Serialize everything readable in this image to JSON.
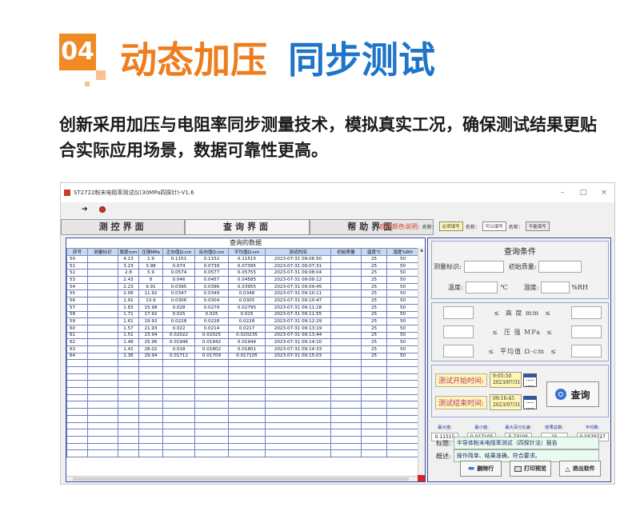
{
  "hero": {
    "badge": "04",
    "title_part1": "动态加压",
    "title_part2": "同步测试",
    "intro": "创新采用加压与电阻率同步测量技术，模拟真实工况，确保测试结果更贴合实际应用场景，数据可靠性更高。"
  },
  "window": {
    "title": "ST2722粉末电阻率测试仪(30MPa四探针)-V1.6",
    "controls": [
      "–",
      "□",
      "×"
    ]
  },
  "tabs": [
    {
      "label": "测控界面"
    },
    {
      "label": "查询界面"
    },
    {
      "label": "帮助界面"
    }
  ],
  "legend": {
    "title": "底纹颜色说明:",
    "items": [
      {
        "name": "名称：",
        "swatch": "必须填写",
        "style": "yellow"
      },
      {
        "name": "名称：",
        "swatch": "可以填写",
        "style": "white"
      },
      {
        "name": "名称：",
        "swatch": "不能填写",
        "style": "gray"
      }
    ]
  },
  "grid": {
    "title": "查询的数据",
    "columns": [
      "序号",
      "测量标识",
      "厚度mm",
      "压强MPa",
      "正向值Ω-cm",
      "反向值Ω-cm",
      "平均值Ω-cm",
      "测试时间",
      "初始质量",
      "温度℃",
      "湿度%RH"
    ],
    "rows": [
      [
        "50",
        "",
        "4.13",
        "1.9",
        "0.1151",
        "0.1152",
        "0.11515",
        "2023-07-31 09:06:50",
        "",
        "25",
        "50"
      ],
      [
        "51",
        "",
        "3.23",
        "3.98",
        "0.074",
        "0.0739",
        "0.07395",
        "2023-07-31 09:07:31",
        "",
        "25",
        "50"
      ],
      [
        "52",
        "",
        "2.8",
        "5.9",
        "0.0574",
        "0.0577",
        "0.05755",
        "2023-07-31 09:08:04",
        "",
        "25",
        "50"
      ],
      [
        "53",
        "",
        "2.43",
        "8",
        "0.046",
        "0.0457",
        "0.04585",
        "2023-07-31 09:09:12",
        "",
        "25",
        "50"
      ],
      [
        "54",
        "",
        "2.23",
        "9.91",
        "0.0395",
        "0.0396",
        "0.03955",
        "2023-07-31 09:09:45",
        "",
        "25",
        "50"
      ],
      [
        "55",
        "",
        "2.06",
        "11.92",
        "0.0347",
        "0.0349",
        "0.0348",
        "2023-07-31 09:10:11",
        "",
        "25",
        "50"
      ],
      [
        "56",
        "",
        "1.91",
        "13.9",
        "0.0306",
        "0.0304",
        "0.0305",
        "2023-07-31 09:10:47",
        "",
        "25",
        "50"
      ],
      [
        "57",
        "",
        "1.83",
        "15.98",
        "0.028",
        "0.0279",
        "0.02795",
        "2023-07-31 09:11:18",
        "",
        "25",
        "50"
      ],
      [
        "58",
        "",
        "1.71",
        "17.92",
        "0.025",
        "0.025",
        "0.025",
        "2023-07-31 09:11:55",
        "",
        "25",
        "50"
      ],
      [
        "59",
        "",
        "1.61",
        "19.92",
        "0.0228",
        "0.0228",
        "0.0228",
        "2023-07-31 09:12:29",
        "",
        "25",
        "50"
      ],
      [
        "60",
        "",
        "1.57",
        "21.93",
        "0.022",
        "0.0214",
        "0.0217",
        "2023-07-31 09:13:19",
        "",
        "25",
        "50"
      ],
      [
        "61",
        "",
        "1.51",
        "23.94",
        "0.02022",
        "0.02025",
        "0.020235",
        "2023-07-31 09:13:44",
        "",
        "25",
        "50"
      ],
      [
        "62",
        "",
        "1.48",
        "25.96",
        "0.01946",
        "0.01942",
        "0.01944",
        "2023-07-31 09:14:10",
        "",
        "25",
        "50"
      ],
      [
        "63",
        "",
        "1.41",
        "28.02",
        "0.018",
        "0.01802",
        "0.01801",
        "2023-07-31 09:14:33",
        "",
        "25",
        "50"
      ],
      [
        "64",
        "",
        "1.36",
        "29.94",
        "0.01712",
        "0.01709",
        "0.017105",
        "2023-07-31 09:15:03",
        "",
        "25",
        "50"
      ]
    ],
    "empty_rows": 14
  },
  "query": {
    "title": "查询条件",
    "measure_id_label": "测量标识:",
    "initial_mass_label": "初始质量:",
    "temp_label": "温度:",
    "temp_unit": "℃",
    "humidity_label": "湿度:",
    "humidity_unit": "%RH",
    "range_le": "≤",
    "range_thickness": "高 度 mm",
    "range_pressure": "压 强 MPa",
    "range_average": "平均值 Ω-cm",
    "start_label": "测试开始时间:",
    "start_time": "9:05:50",
    "start_date": "2023/07/31",
    "end_label": "测试结束时间:",
    "end_time": "09:16:45",
    "end_date": "2023/07/31",
    "query_button": "查询"
  },
  "stats": [
    {
      "label": "最大值:",
      "value": "0.11515"
    },
    {
      "label": "最小值:",
      "value": "0.017105"
    },
    {
      "label": "最大百分比差:",
      "value": "5.73195"
    },
    {
      "label": "结果总数:",
      "value": "15"
    },
    {
      "label": "平均数:",
      "value": "0.0379727"
    }
  ],
  "report": {
    "title_label": "标题:",
    "title_value": "半导体粉末电阻率测试（四探针法）报告",
    "summary_label": "概述:",
    "summary_value": "操作简单、结果准确、符合要求。"
  },
  "buttons": {
    "delete": "删除行",
    "print": "打印预览",
    "exit": "退出软件"
  }
}
